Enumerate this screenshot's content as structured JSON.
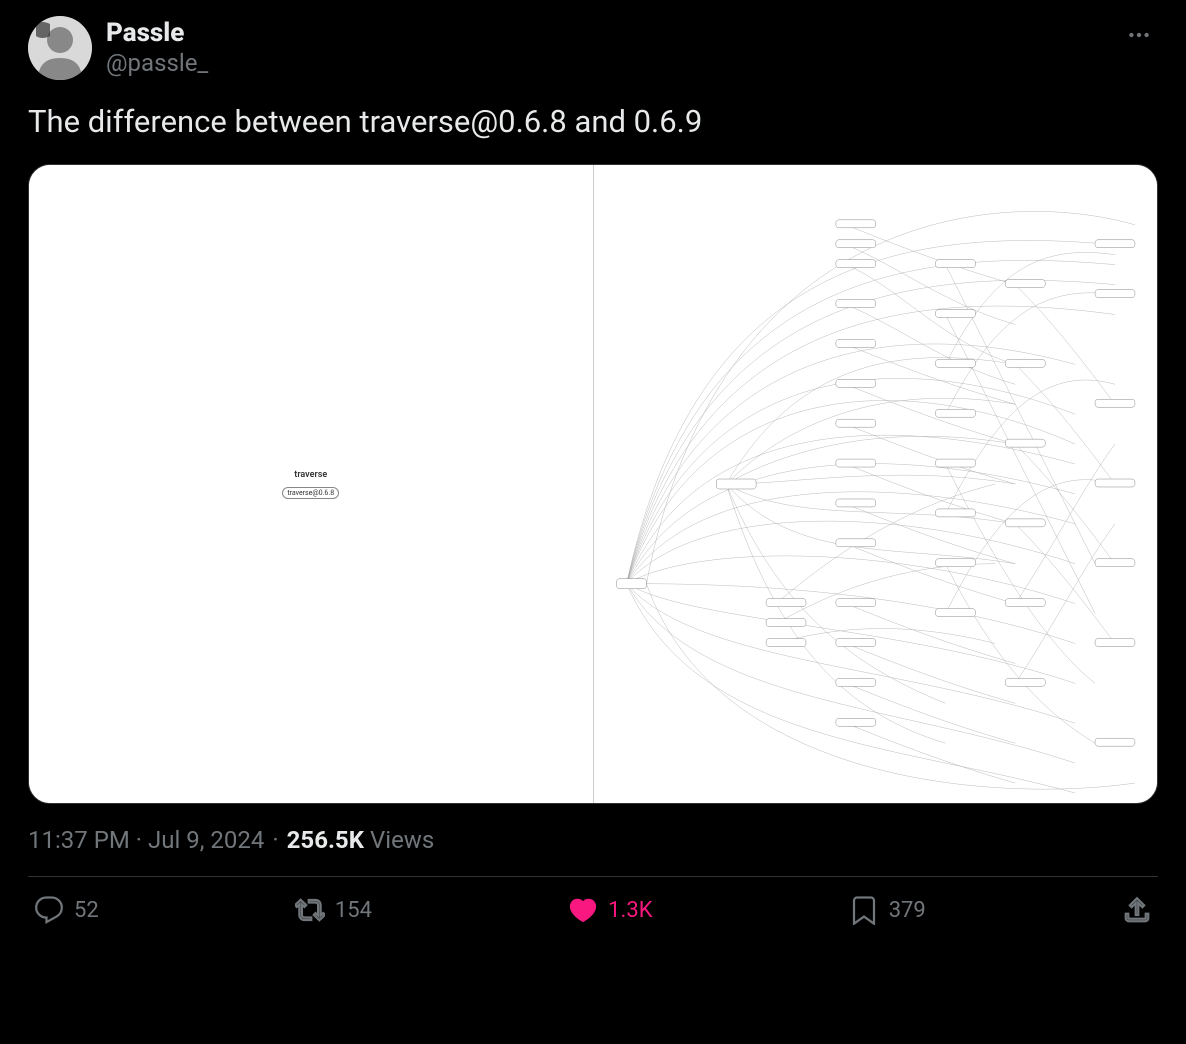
{
  "author": {
    "name": "Passle",
    "handle": "@passle_"
  },
  "tweet_text": "The difference between traverse@0.6.8 and 0.6.9",
  "media": {
    "left_label": "traverse",
    "left_node": "traverse@0.6.8"
  },
  "timestamp": "11:37 PM · Jul 9, 2024",
  "views_count": "256.5K",
  "views_label": "Views",
  "actions": {
    "reply_count": "52",
    "retweet_count": "154",
    "like_count": "1.3K",
    "bookmark_count": "379"
  },
  "colors": {
    "like_active": "#f91880",
    "text_secondary": "#71767b"
  }
}
